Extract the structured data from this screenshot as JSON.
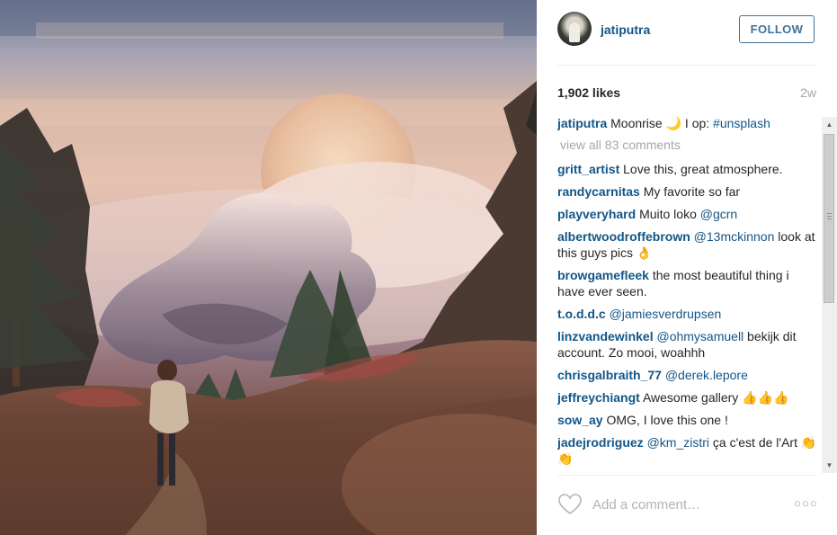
{
  "post": {
    "username": "jatiputra",
    "follow_label": "FOLLOW",
    "likes": "1,902 likes",
    "age": "2w"
  },
  "caption": {
    "user": "jatiputra",
    "text": "Moonrise 🌙 I op: ",
    "tag": "#unsplash"
  },
  "view_all": "view all 83 comments",
  "comments": [
    {
      "user": "gritt_artist",
      "text": "Love this, great atmosphere.",
      "mention": ""
    },
    {
      "user": "randycarnitas",
      "text": "My favorite so far",
      "mention": ""
    },
    {
      "user": "playveryhard",
      "text": "Muito loko ",
      "mention": "@gcrn"
    },
    {
      "user": "albertwoodroffebrown",
      "text": " look at this guys pics 👌",
      "mention": "@13mckinnon"
    },
    {
      "user": "browgamefleek",
      "text": "the most beautiful thing i have ever seen.",
      "mention": ""
    },
    {
      "user": "t.o.d.d.c",
      "text": "",
      "mention": "@jamiesverdrupsen"
    },
    {
      "user": "linzvandewinkel",
      "text": " bekijk dit account. Zo mooi, woahhh",
      "mention": "@ohmysamuell"
    },
    {
      "user": "chrisgalbraith_77",
      "text": "",
      "mention": "@derek.lepore"
    },
    {
      "user": "jeffreychiangt",
      "text": "Awesome gallery 👍👍👍",
      "mention": ""
    },
    {
      "user": "sow_ay",
      "text": "OMG, I love this one !",
      "mention": ""
    },
    {
      "user": "jadejrodriguez",
      "text": " ça c'est de l'Art 👏👏",
      "mention": "@km_zistri"
    }
  ],
  "footer": {
    "add_comment_placeholder": "Add a comment…",
    "more_label": "○○○"
  },
  "icons": {
    "heart": "heart-icon",
    "more": "more-options-icon"
  },
  "colors": {
    "link": "#125688",
    "follow_border": "#3f729b",
    "muted": "#a5a7aa"
  }
}
